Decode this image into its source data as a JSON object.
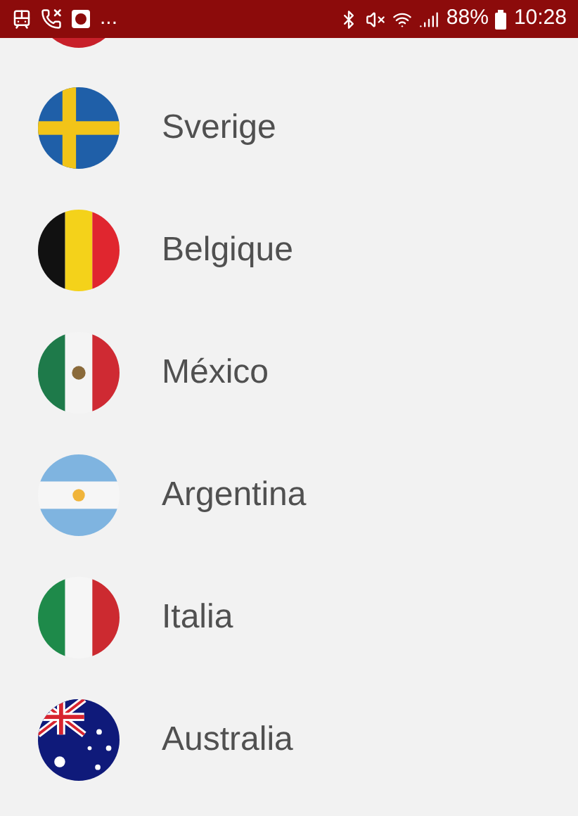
{
  "status_bar": {
    "overflow": "...",
    "battery": "88%",
    "time": "10:28"
  },
  "countries": [
    {
      "name": "Sverige",
      "kind": "sweden"
    },
    {
      "name": "Belgique",
      "kind": "belgium"
    },
    {
      "name": "México",
      "kind": "mexico"
    },
    {
      "name": "Argentina",
      "kind": "argentina"
    },
    {
      "name": "Italia",
      "kind": "italy"
    },
    {
      "name": "Australia",
      "kind": "australia"
    }
  ]
}
